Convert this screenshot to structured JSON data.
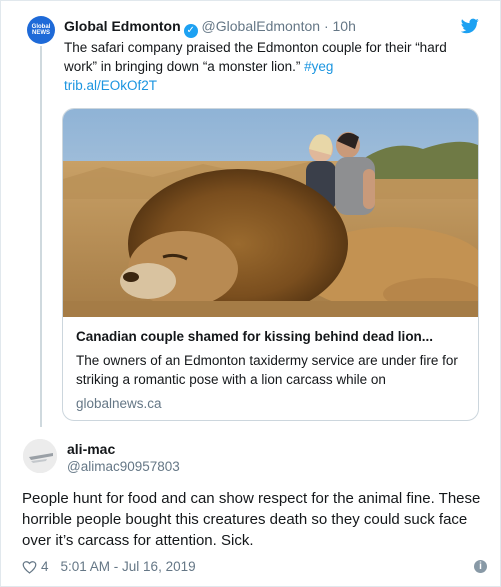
{
  "quoted_tweet": {
    "avatar_text": "Global NEWS",
    "name": "Global Edmonton",
    "handle": "@GlobalEdmonton",
    "separator": "·",
    "time": "10h",
    "text_part1": "The safari company praised the Edmonton couple for their “hard work” in bringing down “a monster lion.” ",
    "hashtag": "#yeg",
    "link": "trib.al/EOkOf2T",
    "card": {
      "title": "Canadian couple shamed for kissing behind dead lion...",
      "description": "The owners of an Edmonton taxidermy service are under fire for striking a romantic pose with a lion carcass while on",
      "domain": "globalnews.ca"
    }
  },
  "reply": {
    "name": "ali-mac",
    "handle": "@alimac90957803",
    "text": "People hunt for food and can show respect for the animal fine. These horrible people bought this creatures death so they could suck face over it’s carcass for attention. Sick.",
    "likes": "4",
    "timestamp": "5:01 AM - Jul 16, 2019"
  },
  "colors": {
    "accent": "#1da1f2",
    "link": "#1b95e0",
    "muted": "#657786",
    "brand_avatar": "#1e6ad8"
  },
  "icons": [
    "verified-icon",
    "twitter-bird-icon",
    "heart-icon",
    "info-icon"
  ]
}
